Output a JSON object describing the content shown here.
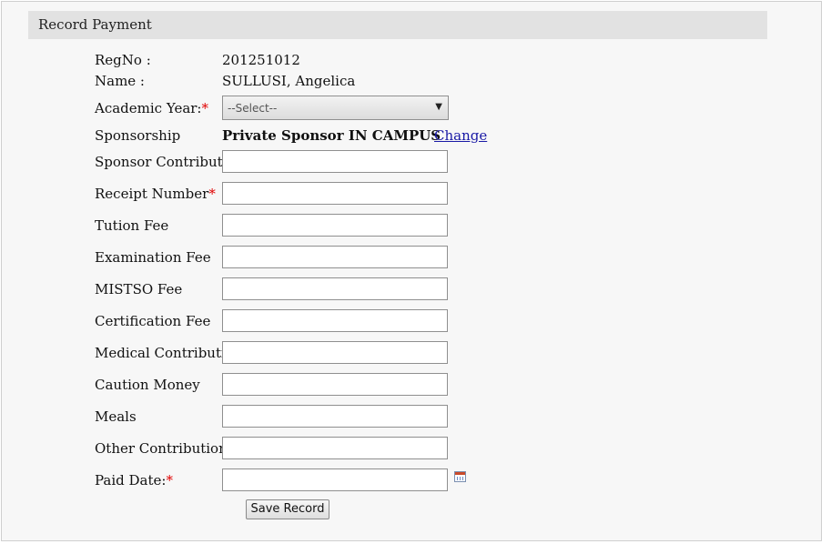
{
  "panel": {
    "title": "Record Payment"
  },
  "student": {
    "regno_label": "RegNo :",
    "regno_value": "201251012",
    "name_label": "Name :",
    "name_value": "SULLUSI, Angelica"
  },
  "academic_year": {
    "label": "Academic Year:",
    "required_mark": "*",
    "selected": "--Select--"
  },
  "sponsorship": {
    "label": "Sponsorship",
    "value": "Private Sponsor IN CAMPUS",
    "change_link": "Change"
  },
  "fields": {
    "sponsor_contribution": {
      "label": "Sponsor Contribution",
      "value": ""
    },
    "receipt_number": {
      "label": "Receipt Number",
      "required_mark": "*",
      "value": ""
    },
    "tution_fee": {
      "label": "Tution Fee",
      "value": ""
    },
    "examination_fee": {
      "label": "Examination Fee",
      "value": ""
    },
    "mistso_fee": {
      "label": "MISTSO Fee",
      "value": ""
    },
    "certification_fee": {
      "label": "Certification Fee",
      "value": ""
    },
    "medical_contribution": {
      "label": "Medical Contribution",
      "value": ""
    },
    "caution_money": {
      "label": "Caution Money",
      "value": ""
    },
    "meals": {
      "label": "Meals",
      "value": ""
    },
    "other_contributions": {
      "label": "Other Contributions",
      "value": ""
    },
    "paid_date": {
      "label": "Paid Date:",
      "required_mark": "*",
      "value": "",
      "icon": "calendar-icon"
    }
  },
  "actions": {
    "save_label": "Save Record"
  }
}
